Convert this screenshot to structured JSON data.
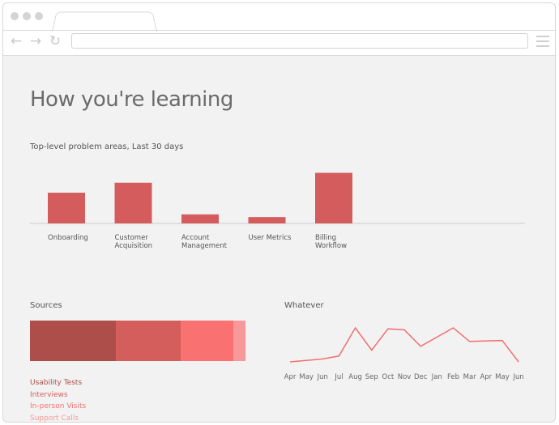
{
  "page": {
    "title": "How you're learning"
  },
  "problem_areas": {
    "subtitle": "Top-level problem areas, Last 30 days",
    "bar_color": "#d45c5c"
  },
  "sources": {
    "label": "Sources",
    "segments": [
      {
        "name": "Usability Tests",
        "share": 0.4,
        "color": "#ad4e4b"
      },
      {
        "name": "Interviews",
        "share": 0.3,
        "color": "#d45e5c"
      },
      {
        "name": "In-person Visits",
        "share": 0.245,
        "color": "#f97170"
      },
      {
        "name": "Support Calls",
        "share": 0.055,
        "color": "#f99898"
      }
    ]
  },
  "trend": {
    "label": "Whatever",
    "line_color": "#f07070"
  },
  "chart_data": [
    {
      "type": "bar",
      "title": "Top-level problem areas, Last 30 days",
      "categories": [
        [
          "Onboarding"
        ],
        [
          "Customer",
          "Acquisition"
        ],
        [
          "Account",
          "Management"
        ],
        [
          "User Metrics"
        ],
        [
          "Billing",
          "Workflow"
        ]
      ],
      "values": [
        34,
        45,
        10,
        7,
        56
      ],
      "ylim": [
        0,
        60
      ],
      "grid": false
    },
    {
      "type": "line",
      "title": "Whatever",
      "categories": [
        "Apr",
        "May",
        "Jun",
        "Jul",
        "Aug",
        "Sep",
        "Oct",
        "Nov",
        "Dec",
        "Jan",
        "Feb",
        "Mar",
        "Apr",
        "May",
        "Jun"
      ],
      "values": [
        0,
        3,
        6,
        35,
        12,
        34,
        33,
        16,
        35,
        21,
        22,
        0
      ],
      "value_positions": [
        0,
        2,
        3,
        4,
        5,
        6,
        7,
        8,
        10,
        11,
        13,
        14
      ],
      "ylim": [
        0,
        40
      ],
      "grid": false
    }
  ]
}
